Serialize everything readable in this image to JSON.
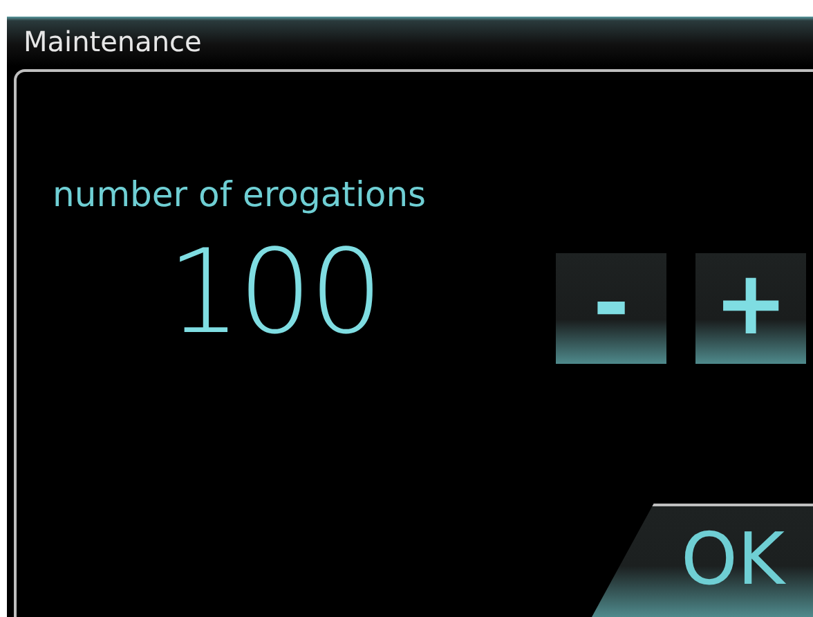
{
  "window": {
    "title": "Maintenance"
  },
  "counter": {
    "label": "number of erogations",
    "value": "100",
    "decrement": "-",
    "increment": "+"
  },
  "buttons": [
    {
      "kind": "confirm",
      "label": "OK"
    }
  ]
}
